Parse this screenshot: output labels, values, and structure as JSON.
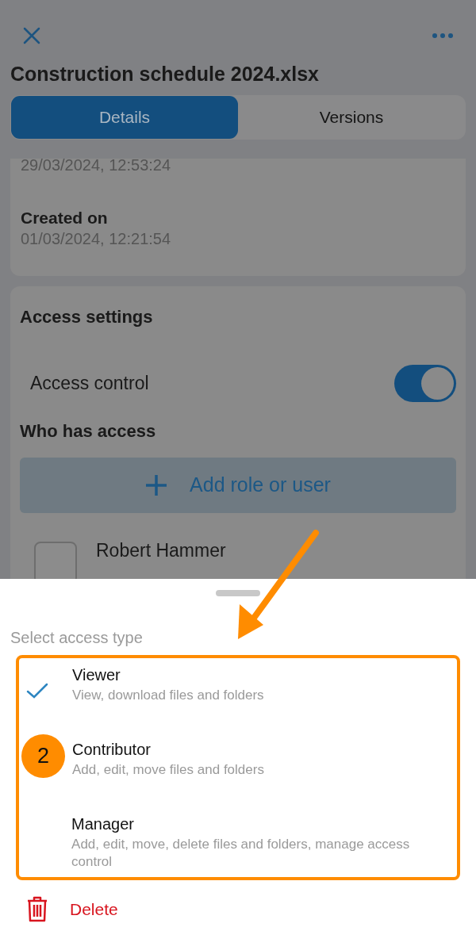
{
  "title": "Construction schedule 2024.xlsx",
  "tabs": [
    {
      "label": "Details",
      "selected": true
    },
    {
      "label": "Versions",
      "selected": false
    }
  ],
  "dates_card": {
    "modified_value": "29/03/2024, 12:53:24",
    "created_label": "Created on",
    "created_value": "01/03/2024, 12:21:54"
  },
  "access_settings": {
    "title": "Access settings",
    "access_control": {
      "label": "Access control",
      "on": true
    },
    "who_has_access": "Who has access",
    "add_button": "Add role or user",
    "users": [
      {
        "name": "Robert Hammer"
      }
    ]
  },
  "sheet": {
    "title": "Select access type",
    "options": [
      {
        "name": "Viewer",
        "description": "View, download files and folders",
        "selected": true
      },
      {
        "name": "Contributor",
        "description": "Add, edit, move files and folders",
        "selected": false
      },
      {
        "name": "Manager",
        "description": "Add, edit, move, delete files and folders, manage access control",
        "selected": false
      }
    ],
    "delete": "Delete"
  },
  "annotation": {
    "badge": "2"
  }
}
